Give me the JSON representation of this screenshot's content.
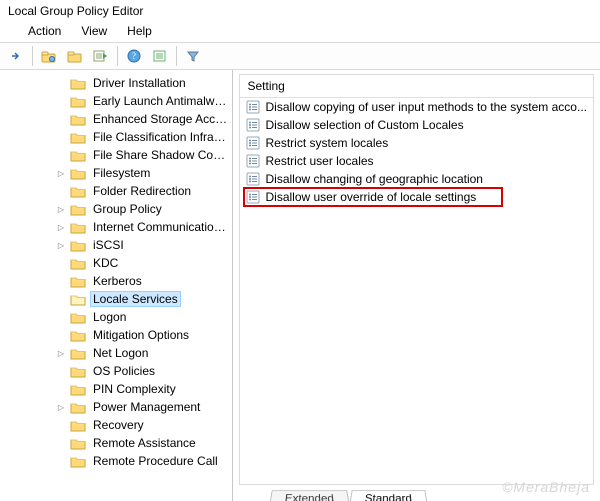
{
  "window": {
    "title": "Local Group Policy Editor"
  },
  "menus": {
    "action": "Action",
    "view": "View",
    "help": "Help"
  },
  "tree": {
    "items": [
      {
        "label": "Driver Installation",
        "expandable": false
      },
      {
        "label": "Early Launch Antimalware",
        "expandable": false
      },
      {
        "label": "Enhanced Storage Access",
        "expandable": false
      },
      {
        "label": "File Classification Infrastruct",
        "expandable": false
      },
      {
        "label": "File Share Shadow Copy Pro",
        "expandable": false
      },
      {
        "label": "Filesystem",
        "expandable": true
      },
      {
        "label": "Folder Redirection",
        "expandable": false
      },
      {
        "label": "Group Policy",
        "expandable": true
      },
      {
        "label": "Internet Communication Ma",
        "expandable": true
      },
      {
        "label": "iSCSI",
        "expandable": true
      },
      {
        "label": "KDC",
        "expandable": false
      },
      {
        "label": "Kerberos",
        "expandable": false
      },
      {
        "label": "Locale Services",
        "expandable": false,
        "selected": true
      },
      {
        "label": "Logon",
        "expandable": false
      },
      {
        "label": "Mitigation Options",
        "expandable": false
      },
      {
        "label": "Net Logon",
        "expandable": true
      },
      {
        "label": "OS Policies",
        "expandable": false
      },
      {
        "label": "PIN Complexity",
        "expandable": false
      },
      {
        "label": "Power Management",
        "expandable": true
      },
      {
        "label": "Recovery",
        "expandable": false
      },
      {
        "label": "Remote Assistance",
        "expandable": false
      },
      {
        "label": "Remote Procedure Call",
        "expandable": false
      }
    ]
  },
  "settings": {
    "header": "Setting",
    "rows": [
      "Disallow copying of user input methods to the system acco...",
      "Disallow selection of Custom Locales",
      "Restrict system locales",
      "Restrict user locales",
      "Disallow changing of geographic location",
      "Disallow user override of locale settings"
    ]
  },
  "tabs": {
    "extended": "Extended",
    "standard": "Standard"
  },
  "watermark": "©MeraBheja"
}
